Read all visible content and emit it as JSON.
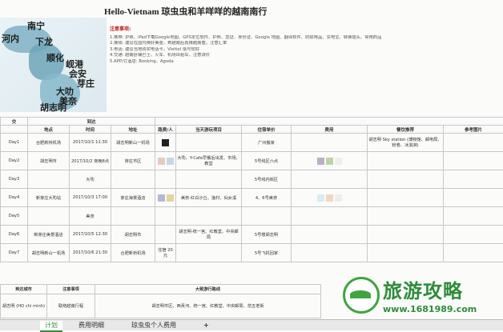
{
  "title": "Hello-Vietnam 琼虫虫和羊咩咩的越南南行",
  "map": {
    "cities": [
      "南宁",
      "河内",
      "下龙",
      "顺化",
      "岘港",
      "会安",
      "芽庄",
      "大叻",
      "美奈",
      "胡志明"
    ]
  },
  "notes": {
    "heading": "注意事项:",
    "lines": [
      "1.携带: 护照、iPad下载Google地图、GPS定位软件、护照、签证、身份证、Google 地图、翻译软件、防蚊用品、充电宝、转换插头、常用药品",
      "2.换钱: 建议在国内换好美金，到越南后再换越南盾，注意汇率",
      "3.电话: 建议当地购买电话卡，Viettel 信号较好",
      "4.交通: 越南卧铺巴士、火车、机场出租车，注意讲价",
      "5.APP/订酒店: Booking、Agoda"
    ]
  },
  "table": {
    "group_labels": [
      "交",
      "到达"
    ],
    "headers": [
      "地点",
      "时间",
      "地址",
      "路费/人",
      "当天游玩项目",
      "住宿单价",
      "费用",
      "餐饮推荐",
      "参考图片"
    ],
    "rows": [
      {
        "day": "Day1",
        "place": "合肥新桥机场",
        "time": "2017/10/1 11:30",
        "addr": "胡志明新山一机场",
        "fee": "",
        "plan": "",
        "stay": "广州搬家",
        "cost": "",
        "food": "胡志明 Sky station (博物馆、邮电局、粉卷、冰淇淋)",
        "ref": ""
      },
      {
        "day": "Day2",
        "place": "胡志明市",
        "time": "2017/10/2 夜晚8点",
        "addr": "芽庄市区",
        "fee": "",
        "plan": "大叻、Y-Cafe早餐后出发、市场、教堂",
        "stay": "5号线区六点",
        "cost": "",
        "food": "",
        "ref": ""
      },
      {
        "day": "Day3",
        "place": "",
        "time": "大叻",
        "addr": "",
        "fee": "",
        "plan": "",
        "stay": "5号线内街区",
        "cost": "",
        "food": "",
        "ref": ""
      },
      {
        "day": "Day4",
        "place": "新芽庄大叻站",
        "time": "2017/10/3 17:00",
        "addr": "芽庄海景酒店",
        "fee": "",
        "plan": "美奈-红白沙丘、渔村、仙女溪",
        "stay": "4、6号美奈",
        "cost": "",
        "food": "",
        "ref": ""
      },
      {
        "day": "Day5",
        "place": "",
        "time": "美奈",
        "addr": "",
        "fee": "",
        "plan": "",
        "stay": "",
        "cost": "",
        "food": "",
        "ref": ""
      },
      {
        "day": "Day6",
        "place": "新芽庄美景酒店",
        "time": "2017/10/5 12:30",
        "addr": "胡志明市",
        "fee": "",
        "plan": "胡志明-统一宫、红教堂、中央邮局",
        "stay": "5号楼胡志明",
        "cost": "",
        "food": "",
        "ref": ""
      },
      {
        "day": "Day7",
        "place": "胡志明新山一机场",
        "time": "2017/10/6 21:30",
        "addr": "合肥新桥机场",
        "fee": "住宿 20元",
        "plan": "",
        "stay": "5号飞机回家",
        "cost": "",
        "food": "",
        "ref": ""
      }
    ]
  },
  "bottom_table": {
    "headers": [
      "到达城市",
      "注意事项",
      "大致游行路线"
    ],
    "rows": [
      {
        "city": "胡志明 (HO chi minh)",
        "note": "联络越南行程",
        "route": "胡志明市区、西贡河、统一宫、红教堂、中央邮局、范五老街"
      }
    ]
  },
  "tabs": [
    "计划",
    "费用明细",
    "琼虫虫个人费用",
    "+"
  ],
  "watermark": {
    "brand": "旅游攻略",
    "url": "www.1681989.com"
  }
}
